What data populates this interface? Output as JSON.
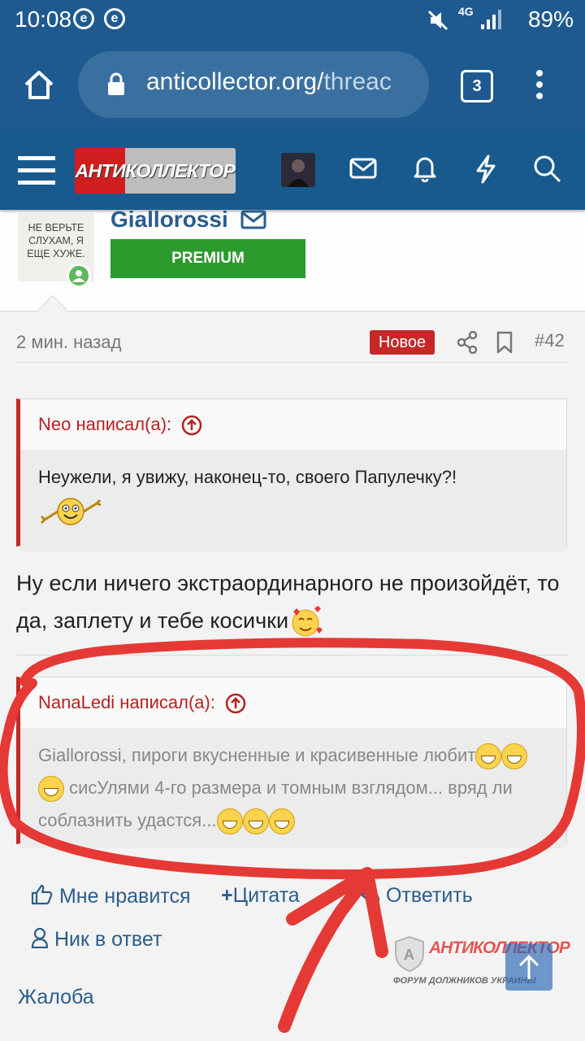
{
  "status_bar": {
    "time": "10:08",
    "notif_icons": [
      "e",
      "e"
    ],
    "network": "4G",
    "battery": "89%"
  },
  "browser": {
    "url_main": "anticollector.org/",
    "url_tail": "threac",
    "tab_count": "3"
  },
  "site": {
    "logo_text": "АНТИКОЛЛЕКТОР"
  },
  "post": {
    "avatar_text": "НЕ ВЕРЬТЕ СЛУХАМ, Я ЕЩЕ ХУЖЕ.",
    "username": "Giallorossi",
    "user_badge": "PREMIUM",
    "time_ago": "2 мин. назад",
    "new_badge": "Новое",
    "post_number": "#42",
    "quote1": {
      "author_line": "Neo написал(а):",
      "text": "Неужели, я увижу, наконец-то, своего Папулечку?!"
    },
    "reply_text": "Ну если ничего экстраординарного не произойдёт, то да, заплету и тебе косички",
    "quote2": {
      "author_line": "NanaLedi написал(а):",
      "text_part1": "Giallorossi, пироги вкусненные и красивенные любит",
      "text_part2": " сисУлями 4-го размера и томным взглядом... вряд ли соблазнить удастся..."
    },
    "actions": {
      "like": "Мне нравится",
      "quote": "Цитата",
      "reply": "Ответить",
      "nick_reply": "Ник в ответ",
      "report": "Жалоба"
    }
  },
  "watermark": {
    "brand": "АНТИКОЛЛЕКТОР",
    "tagline": "ФОРУМ ДОЛЖНИКОВ УКРАИНЫ"
  },
  "colors": {
    "header_blue": "#185a8e",
    "link_blue": "#2b5d8c",
    "quote_red": "#c62828",
    "premium_green": "#2d9a2d",
    "annotation_red": "#e53935"
  }
}
